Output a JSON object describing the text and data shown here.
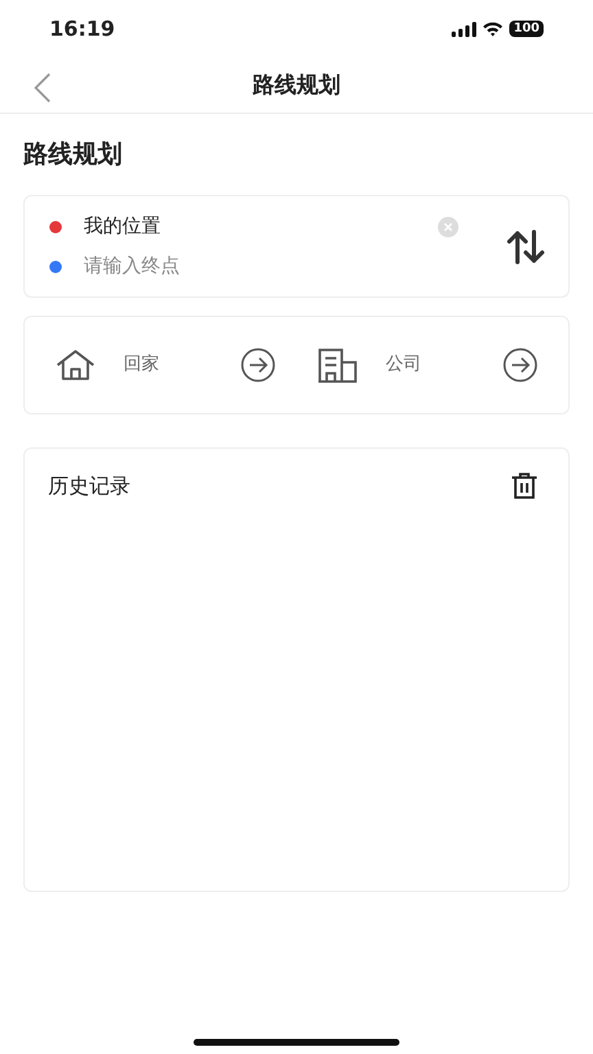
{
  "status_bar": {
    "time": "16:19",
    "battery": "100"
  },
  "nav_bar": {
    "title": "路线规划"
  },
  "heading": "路线规划",
  "route": {
    "start": {
      "value": "我的位置",
      "color": "#e5383b"
    },
    "end": {
      "placeholder": "请输入终点",
      "color": "#3478f6"
    }
  },
  "shortcuts": [
    {
      "kind": "home",
      "label": "回家"
    },
    {
      "kind": "office",
      "label": "公司"
    }
  ],
  "history": {
    "title": "历史记录"
  }
}
